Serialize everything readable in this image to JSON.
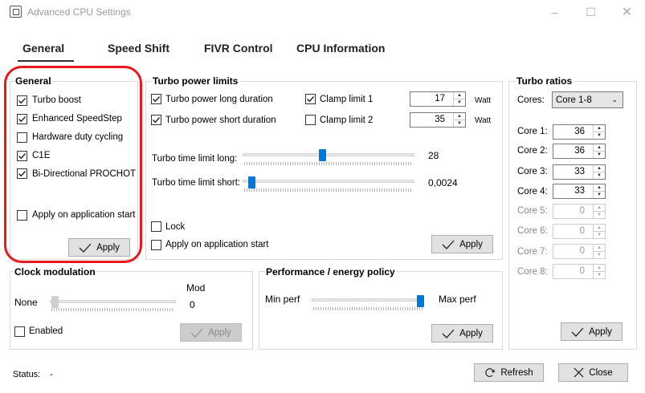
{
  "window": {
    "title": "Advanced CPU Settings"
  },
  "tabs": [
    "General",
    "Speed Shift",
    "FIVR Control",
    "CPU Information"
  ],
  "general": {
    "title": "General",
    "items": [
      {
        "label": "Turbo boost",
        "checked": true
      },
      {
        "label": "Enhanced SpeedStep",
        "checked": true
      },
      {
        "label": "Hardware duty cycling",
        "checked": false
      },
      {
        "label": "C1E",
        "checked": true
      },
      {
        "label": "Bi-Directional PROCHOT",
        "checked": true
      }
    ],
    "apply_on_start": "Apply on application start",
    "apply": "Apply"
  },
  "turbo_power": {
    "title": "Turbo power limits",
    "long_duration": "Turbo power long duration",
    "short_duration": "Turbo power short duration",
    "clamp1": "Clamp limit 1",
    "clamp2": "Clamp limit 2",
    "long_value": "17",
    "short_value": "35",
    "unit": "Watt",
    "time_long_label": "Turbo time limit long:",
    "time_long_value": "28",
    "time_short_label": "Turbo time limit short:",
    "time_short_value": "0,0024",
    "lock": "Lock",
    "apply_on_start": "Apply on application start",
    "apply": "Apply"
  },
  "turbo_ratios": {
    "title": "Turbo ratios",
    "cores_label": "Cores:",
    "cores_selected": "Core 1-8",
    "cores": [
      {
        "label": "Core 1:",
        "value": "36"
      },
      {
        "label": "Core 2:",
        "value": "36"
      },
      {
        "label": "Core 3:",
        "value": "33"
      },
      {
        "label": "Core 4:",
        "value": "33"
      },
      {
        "label": "Core 5:",
        "value": "0"
      },
      {
        "label": "Core 6:",
        "value": "0"
      },
      {
        "label": "Core 7:",
        "value": "0"
      },
      {
        "label": "Core 8:",
        "value": "0"
      }
    ],
    "apply": "Apply"
  },
  "clock_mod": {
    "title": "Clock modulation",
    "none": "None",
    "mod": "Mod",
    "value": "0",
    "enabled": "Enabled",
    "apply": "Apply"
  },
  "perf_policy": {
    "title": "Performance / energy policy",
    "min": "Min perf",
    "max": "Max perf",
    "apply": "Apply"
  },
  "status": {
    "label": "Status:",
    "value": "-"
  },
  "footer": {
    "refresh": "Refresh",
    "close": "Close"
  },
  "colors": {
    "accent": "#0078d7",
    "annotation": "#e8191c"
  }
}
